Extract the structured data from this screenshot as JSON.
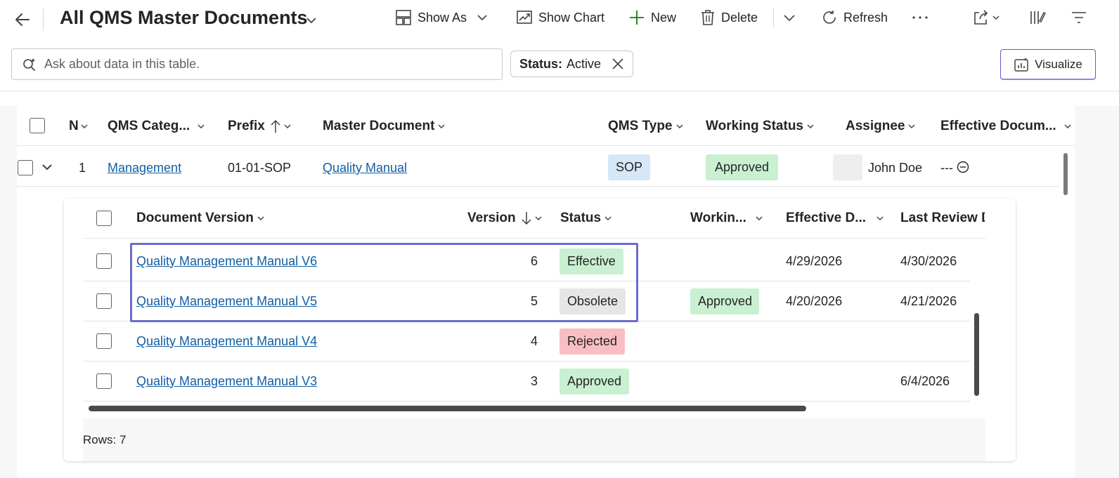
{
  "header": {
    "title": "All QMS Master Documents",
    "commands": {
      "show_as": "Show As",
      "show_chart": "Show Chart",
      "new": "New",
      "delete": "Delete",
      "refresh": "Refresh"
    }
  },
  "search": {
    "placeholder": "Ask about data in this table."
  },
  "filter": {
    "key": "Status:",
    "value": "Active"
  },
  "visualize_label": "Visualize",
  "main_grid": {
    "columns": [
      "N",
      "QMS Categ...",
      "Prefix",
      "Master Document",
      "QMS Type",
      "Working Status",
      "Assignee",
      "Effective Docum..."
    ],
    "rows": [
      {
        "number": "1",
        "category": "Management",
        "prefix": "01-01-SOP",
        "master_document": "Quality Manual",
        "qms_type": "SOP",
        "working_status": "Approved",
        "assignee": "John Doe",
        "effective_document": "---"
      }
    ]
  },
  "sub_grid": {
    "columns": [
      "Document Version",
      "Version",
      "Status",
      "Workin...",
      "Effective D...",
      "Last Review D"
    ],
    "rows": [
      {
        "document_version": "Quality Management Manual V6",
        "version": "6",
        "status": "Effective",
        "working": "",
        "effective_date": "4/29/2026",
        "last_review": "4/30/2026"
      },
      {
        "document_version": "Quality Management Manual V5",
        "version": "5",
        "status": "Obsolete",
        "working": "Approved",
        "effective_date": "4/20/2026",
        "last_review": "4/21/2026"
      },
      {
        "document_version": "Quality Management Manual V4",
        "version": "4",
        "status": "Rejected",
        "working": "",
        "effective_date": "",
        "last_review": ""
      },
      {
        "document_version": "Quality Management Manual V3",
        "version": "3",
        "status": "Approved",
        "working": "",
        "effective_date": "",
        "last_review": "6/4/2026"
      }
    ],
    "footer": "Rows: 7"
  },
  "colors": {
    "link": "#115ea3",
    "pill_blue": "#d6e8f7",
    "pill_green": "#c9f0d1",
    "pill_gray": "#e6e6e6",
    "pill_red": "#f8bec4",
    "highlight": "#6b6bd1"
  },
  "icons": [
    "back-arrow-icon",
    "chevron-down-icon",
    "show-as-grid-icon",
    "chart-icon",
    "plus-icon",
    "trash-icon",
    "refresh-icon",
    "more-icon",
    "share-icon",
    "columns-edit-icon",
    "filter-lines-icon",
    "copilot-sparkle-icon",
    "close-icon",
    "visualize-icon",
    "sort-up-arrow-icon",
    "sort-down-arrow-icon",
    "minus-circle-icon"
  ]
}
